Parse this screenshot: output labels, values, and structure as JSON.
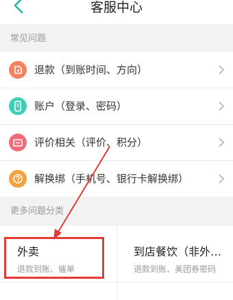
{
  "header": {
    "title": "客服中心"
  },
  "sections": {
    "common": "常见问题",
    "more": "更多问题分类"
  },
  "items": [
    {
      "label": "退款（到账时间、方向）",
      "icon": "refund-icon",
      "color": "#f4845f"
    },
    {
      "label": "账户（登录、密码）",
      "icon": "account-icon",
      "color": "#3fcfb4"
    },
    {
      "label": "评价相关（评价、积分）",
      "icon": "review-icon",
      "color": "#f26b7d"
    },
    {
      "label": "解换绑（手机号、银行卡解换绑）",
      "icon": "unbind-icon",
      "color": "#f5a23c"
    }
  ],
  "categories": [
    {
      "title": "外卖",
      "sub": "退款到账、催单"
    },
    {
      "title": "到店餐饮（非外…",
      "sub": "退款到账、美团券密码"
    }
  ],
  "colors": {
    "accent": "#19b7a5",
    "highlight": "#e53935"
  }
}
